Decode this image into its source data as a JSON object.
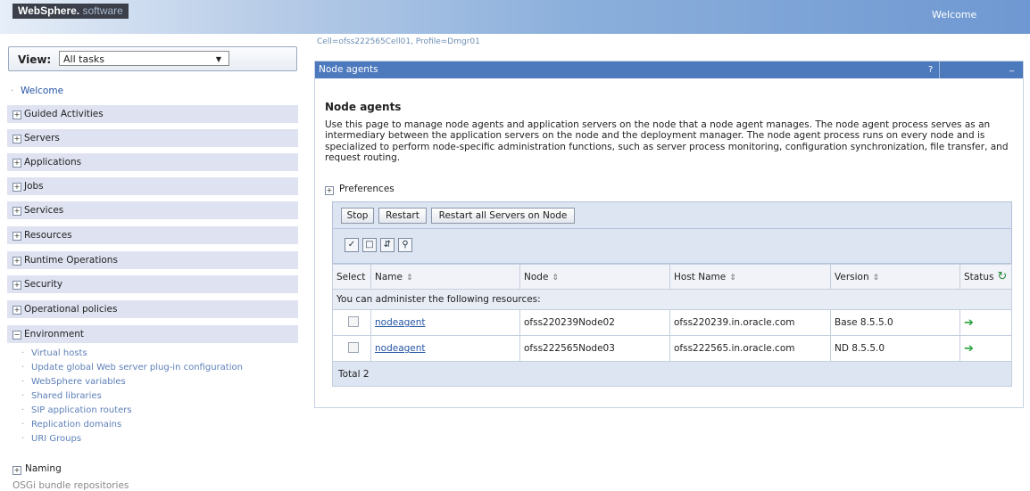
{
  "banner": {
    "brand": "WebSphere.",
    "product": "software",
    "welcome": "Welcome"
  },
  "nav": {
    "view_label": "View:",
    "view_value": "All tasks",
    "welcome_link": "Welcome",
    "sections": [
      "Guided Activities",
      "Servers",
      "Applications",
      "Jobs",
      "Services",
      "Resources",
      "Runtime Operations",
      "Security",
      "Operational policies",
      "Environment"
    ],
    "environment_items": [
      "Virtual hosts",
      "Update global Web server plug-in configuration",
      "WebSphere variables",
      "Shared libraries",
      "SIP application routers",
      "Replication domains",
      "URI Groups"
    ],
    "naming": "Naming",
    "cut_row": "OSGi bundle repositories"
  },
  "main": {
    "breadcrumb": "Cell=ofss222565Cell01, Profile=Dmgr01",
    "panel_title": "Node agents",
    "help": "?",
    "minimize": "_",
    "heading": "Node agents",
    "description": "Use this page to manage node agents and application servers on the node that a node agent manages. The node agent process serves as an intermediary between the application servers on the node and the deployment manager. The node agent process runs on every node and is specialized to perform node-specific administration functions, such as server process monitoring, configuration synchronization, file transfer, and request routing.",
    "preferences": "Preferences",
    "buttons": {
      "stop": "Stop",
      "restart": "Restart",
      "restart_all": "Restart all Servers on Node"
    },
    "table": {
      "headers": {
        "select": "Select",
        "name": "Name",
        "node": "Node",
        "host": "Host Name",
        "version": "Version",
        "status": "Status"
      },
      "message": "You can administer the following resources:",
      "rows": [
        {
          "name": "nodeagent",
          "node": "ofss220239Node02",
          "host": "ofss220239.in.oracle.com",
          "version": "Base 8.5.5.0",
          "status_icon": "started-arrow-icon"
        },
        {
          "name": "nodeagent",
          "node": "ofss222565Node03",
          "host": "ofss222565.in.oracle.com",
          "version": "ND 8.5.5.0",
          "status_icon": "started-arrow-icon"
        }
      ],
      "total": "Total 2"
    }
  },
  "colors": {
    "title_bar": "#4d79bd",
    "nav_header": "#dfe3f1",
    "link": "#2455a4",
    "status_started": "#28a33c"
  }
}
